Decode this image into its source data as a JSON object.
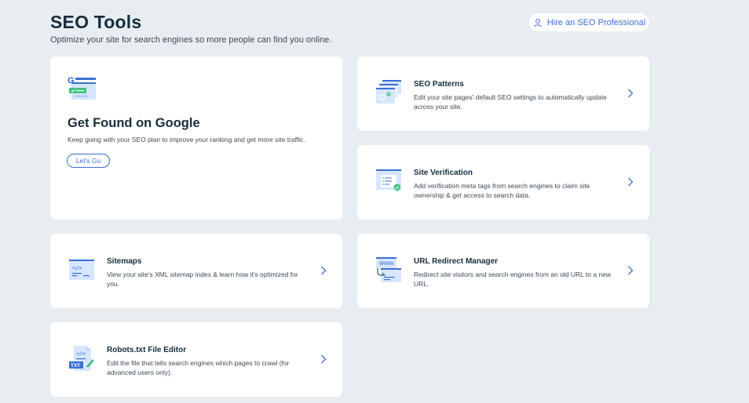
{
  "header": {
    "title": "SEO Tools",
    "subtitle": "Optimize your site for search engines so more people can find you online.",
    "hire_button_label": "Hire an SEO Professional"
  },
  "hero_card": {
    "title": "Get Found on Google",
    "description": "Keep going with your SEO plan to improve your ranking and get more site traffic.",
    "button_label": "Let’s Go",
    "icon": "google-search-icon"
  },
  "cards": [
    {
      "title": "SEO Patterns",
      "description": "Edit your site pages' default SEO settings to automatically update across your site.",
      "icon": "seo-patterns-icon"
    },
    {
      "title": "Site Verification",
      "description": "Add verification meta tags from search engines to claim site ownership & get access to search data.",
      "icon": "site-verification-icon"
    },
    {
      "title": "Sitemaps",
      "description": "View your site's XML sitemap index & learn how it's optimized for you.",
      "icon": "sitemap-icon"
    },
    {
      "title": "URL Redirect Manager",
      "description": "Redirect site visitors and search engines from an old URL to a new URL.",
      "icon": "url-redirect-icon"
    },
    {
      "title": "Robots.txt File Editor",
      "description": "Edit the file that tells search engines which pages to crawl (for advanced users only).",
      "icon": "robots-txt-icon",
      "icon_text": "TXT"
    }
  ],
  "icon_labels": {
    "google_letter": "G",
    "code_tag": "</>",
    "www": "WWW"
  },
  "colors": {
    "background": "#e8edf2",
    "card": "#ffffff",
    "accent_blue": "#3b6fd6",
    "text_dark": "#162d3d",
    "icon_light_blue": "#d6e6fe",
    "icon_green": "#3ec37f"
  }
}
